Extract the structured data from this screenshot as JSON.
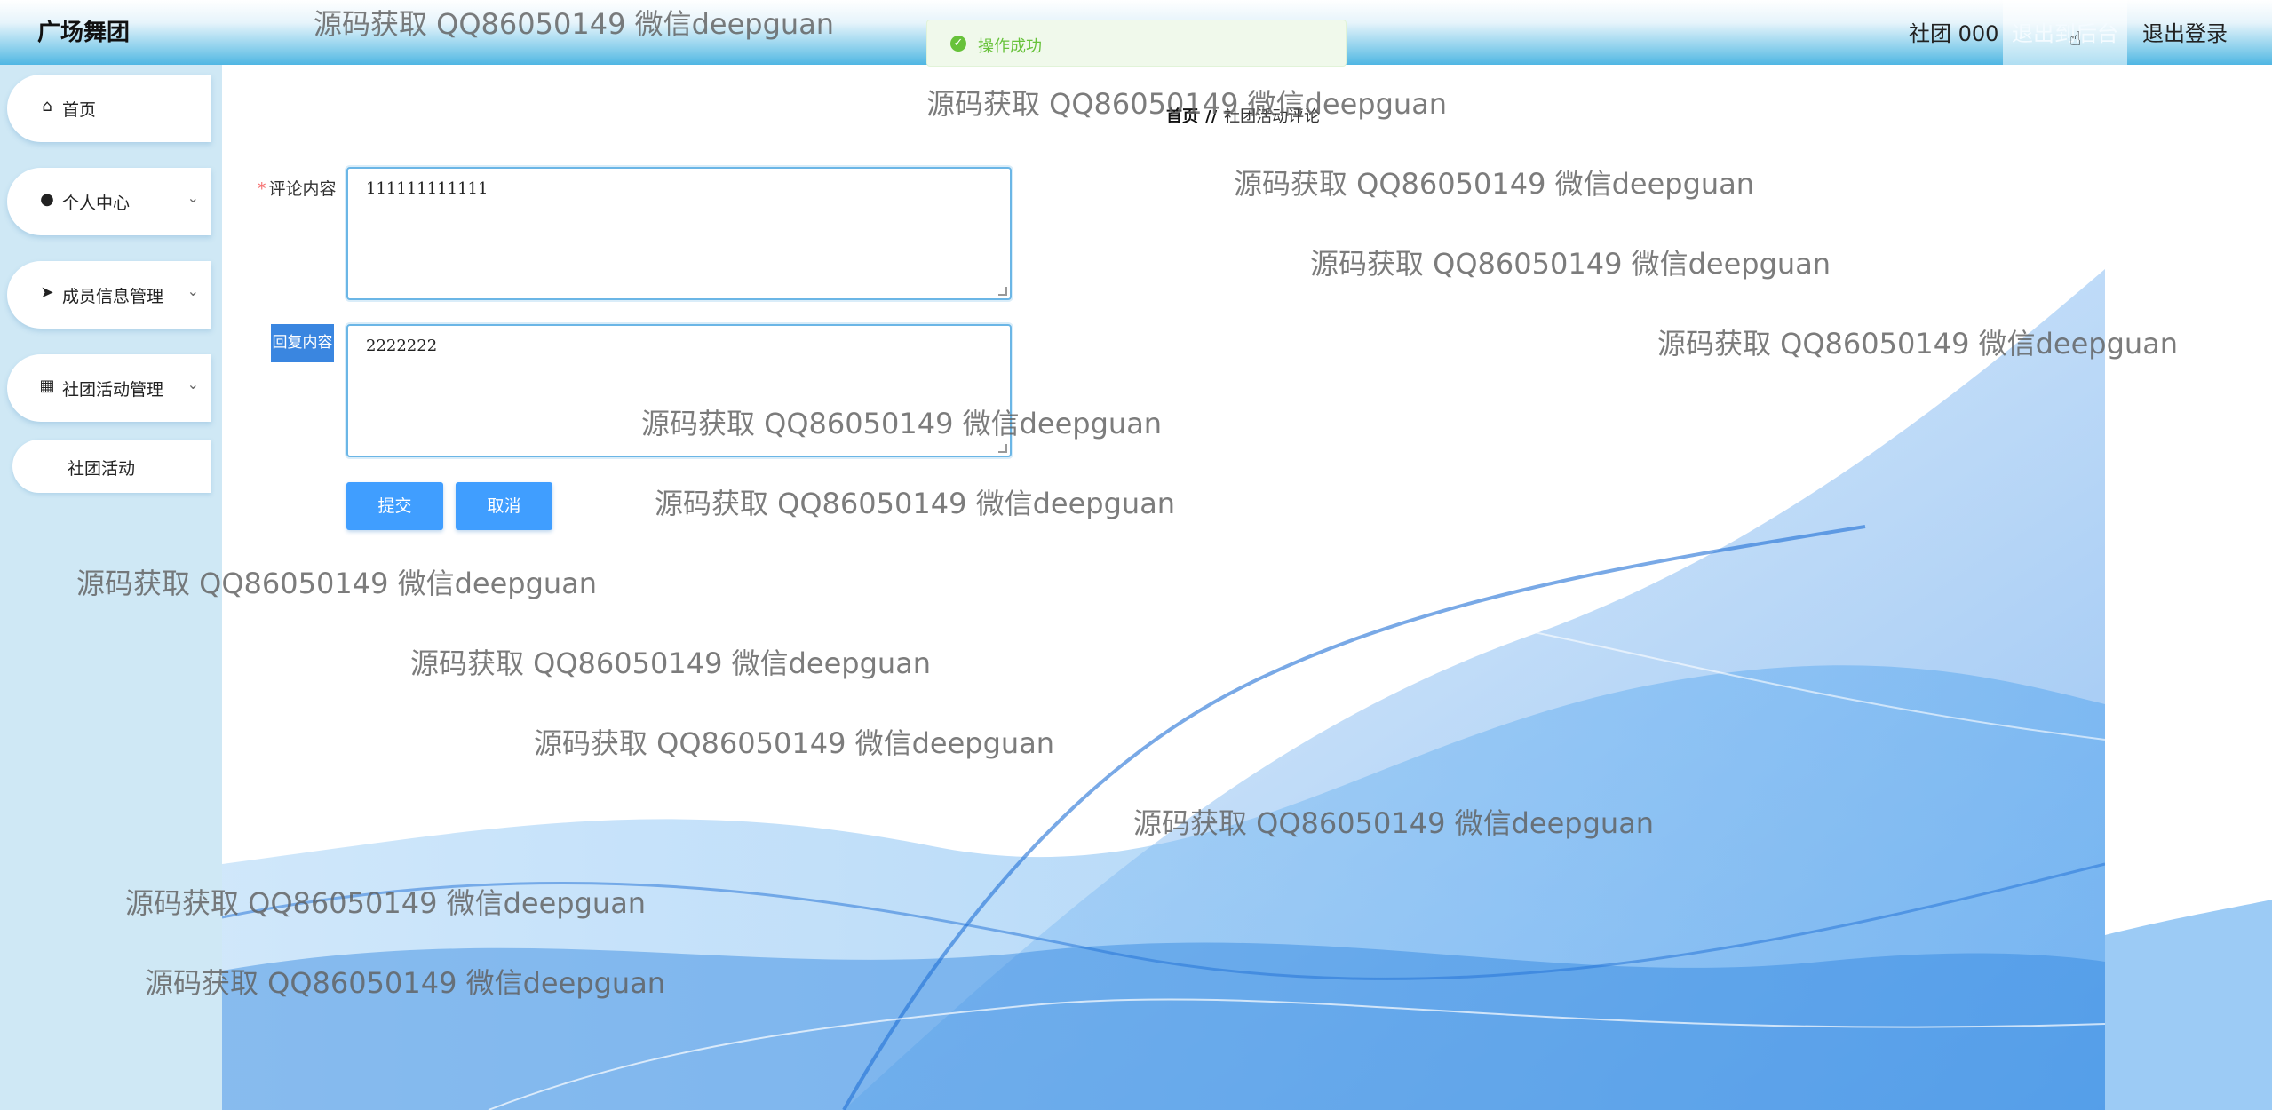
{
  "header": {
    "brand": "广场舞团",
    "user": "社团 000",
    "backend_button": "退出到后台",
    "logout_button": "退出登录"
  },
  "toast": {
    "message": "操作成功"
  },
  "sidebar": {
    "items": [
      {
        "label": "首页",
        "icon": "home-icon"
      },
      {
        "label": "个人中心",
        "icon": "user-icon"
      },
      {
        "label": "成员信息管理",
        "icon": "send-icon"
      },
      {
        "label": "社团活动管理",
        "icon": "grid-icon"
      }
    ],
    "sub_item": "社团活动"
  },
  "breadcrumb": {
    "home": "首页",
    "separator": "//",
    "current": "社团活动评论"
  },
  "form": {
    "comment_label": "评论内容",
    "comment_value": "111111111111",
    "reply_label": "回复内容",
    "reply_value": "2222222",
    "submit": "提交",
    "cancel": "取消"
  },
  "watermark": "源码获取 QQ86050149 微信deepguan",
  "colors": {
    "accent": "#409eff",
    "success": "#67c23a",
    "sidebar_bg": "#cfe8f5"
  }
}
